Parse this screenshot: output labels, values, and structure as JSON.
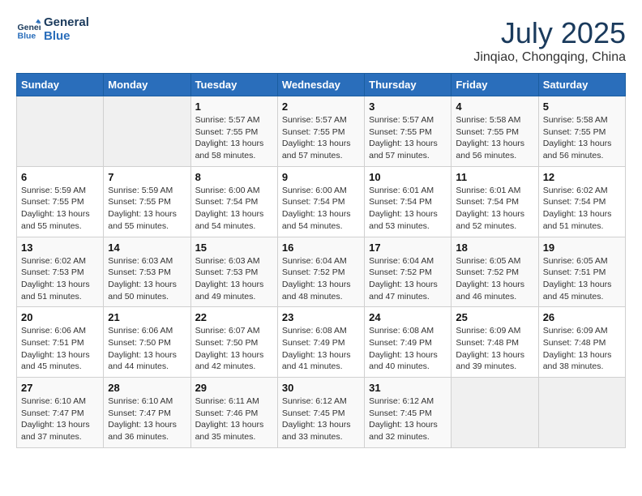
{
  "header": {
    "logo_line1": "General",
    "logo_line2": "Blue",
    "month_year": "July 2025",
    "location": "Jinqiao, Chongqing, China"
  },
  "days_of_week": [
    "Sunday",
    "Monday",
    "Tuesday",
    "Wednesday",
    "Thursday",
    "Friday",
    "Saturday"
  ],
  "weeks": [
    [
      {
        "num": "",
        "empty": true
      },
      {
        "num": "",
        "empty": true
      },
      {
        "num": "1",
        "sunrise": "5:57 AM",
        "sunset": "7:55 PM",
        "daylight": "13 hours and 58 minutes."
      },
      {
        "num": "2",
        "sunrise": "5:57 AM",
        "sunset": "7:55 PM",
        "daylight": "13 hours and 57 minutes."
      },
      {
        "num": "3",
        "sunrise": "5:57 AM",
        "sunset": "7:55 PM",
        "daylight": "13 hours and 57 minutes."
      },
      {
        "num": "4",
        "sunrise": "5:58 AM",
        "sunset": "7:55 PM",
        "daylight": "13 hours and 56 minutes."
      },
      {
        "num": "5",
        "sunrise": "5:58 AM",
        "sunset": "7:55 PM",
        "daylight": "13 hours and 56 minutes."
      }
    ],
    [
      {
        "num": "6",
        "sunrise": "5:59 AM",
        "sunset": "7:55 PM",
        "daylight": "13 hours and 55 minutes."
      },
      {
        "num": "7",
        "sunrise": "5:59 AM",
        "sunset": "7:55 PM",
        "daylight": "13 hours and 55 minutes."
      },
      {
        "num": "8",
        "sunrise": "6:00 AM",
        "sunset": "7:54 PM",
        "daylight": "13 hours and 54 minutes."
      },
      {
        "num": "9",
        "sunrise": "6:00 AM",
        "sunset": "7:54 PM",
        "daylight": "13 hours and 54 minutes."
      },
      {
        "num": "10",
        "sunrise": "6:01 AM",
        "sunset": "7:54 PM",
        "daylight": "13 hours and 53 minutes."
      },
      {
        "num": "11",
        "sunrise": "6:01 AM",
        "sunset": "7:54 PM",
        "daylight": "13 hours and 52 minutes."
      },
      {
        "num": "12",
        "sunrise": "6:02 AM",
        "sunset": "7:54 PM",
        "daylight": "13 hours and 51 minutes."
      }
    ],
    [
      {
        "num": "13",
        "sunrise": "6:02 AM",
        "sunset": "7:53 PM",
        "daylight": "13 hours and 51 minutes."
      },
      {
        "num": "14",
        "sunrise": "6:03 AM",
        "sunset": "7:53 PM",
        "daylight": "13 hours and 50 minutes."
      },
      {
        "num": "15",
        "sunrise": "6:03 AM",
        "sunset": "7:53 PM",
        "daylight": "13 hours and 49 minutes."
      },
      {
        "num": "16",
        "sunrise": "6:04 AM",
        "sunset": "7:52 PM",
        "daylight": "13 hours and 48 minutes."
      },
      {
        "num": "17",
        "sunrise": "6:04 AM",
        "sunset": "7:52 PM",
        "daylight": "13 hours and 47 minutes."
      },
      {
        "num": "18",
        "sunrise": "6:05 AM",
        "sunset": "7:52 PM",
        "daylight": "13 hours and 46 minutes."
      },
      {
        "num": "19",
        "sunrise": "6:05 AM",
        "sunset": "7:51 PM",
        "daylight": "13 hours and 45 minutes."
      }
    ],
    [
      {
        "num": "20",
        "sunrise": "6:06 AM",
        "sunset": "7:51 PM",
        "daylight": "13 hours and 45 minutes."
      },
      {
        "num": "21",
        "sunrise": "6:06 AM",
        "sunset": "7:50 PM",
        "daylight": "13 hours and 44 minutes."
      },
      {
        "num": "22",
        "sunrise": "6:07 AM",
        "sunset": "7:50 PM",
        "daylight": "13 hours and 42 minutes."
      },
      {
        "num": "23",
        "sunrise": "6:08 AM",
        "sunset": "7:49 PM",
        "daylight": "13 hours and 41 minutes."
      },
      {
        "num": "24",
        "sunrise": "6:08 AM",
        "sunset": "7:49 PM",
        "daylight": "13 hours and 40 minutes."
      },
      {
        "num": "25",
        "sunrise": "6:09 AM",
        "sunset": "7:48 PM",
        "daylight": "13 hours and 39 minutes."
      },
      {
        "num": "26",
        "sunrise": "6:09 AM",
        "sunset": "7:48 PM",
        "daylight": "13 hours and 38 minutes."
      }
    ],
    [
      {
        "num": "27",
        "sunrise": "6:10 AM",
        "sunset": "7:47 PM",
        "daylight": "13 hours and 37 minutes."
      },
      {
        "num": "28",
        "sunrise": "6:10 AM",
        "sunset": "7:47 PM",
        "daylight": "13 hours and 36 minutes."
      },
      {
        "num": "29",
        "sunrise": "6:11 AM",
        "sunset": "7:46 PM",
        "daylight": "13 hours and 35 minutes."
      },
      {
        "num": "30",
        "sunrise": "6:12 AM",
        "sunset": "7:45 PM",
        "daylight": "13 hours and 33 minutes."
      },
      {
        "num": "31",
        "sunrise": "6:12 AM",
        "sunset": "7:45 PM",
        "daylight": "13 hours and 32 minutes."
      },
      {
        "num": "",
        "empty": true
      },
      {
        "num": "",
        "empty": true
      }
    ]
  ],
  "labels": {
    "sunrise_prefix": "Sunrise: ",
    "sunset_prefix": "Sunset: ",
    "daylight_prefix": "Daylight: "
  }
}
